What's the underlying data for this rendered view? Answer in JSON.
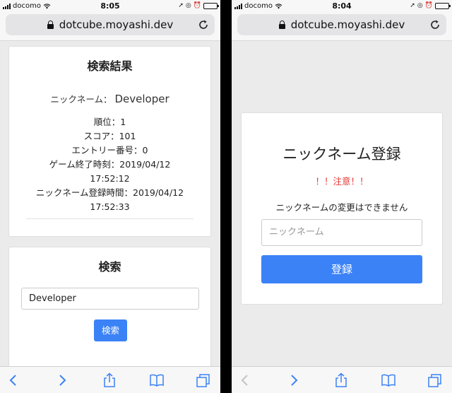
{
  "left": {
    "status": {
      "carrier": "docomo",
      "time": "8:05"
    },
    "url": "dotcube.moyashi.dev",
    "results": {
      "title": "検索結果",
      "nickname_label": "ニックネーム：",
      "nickname_value": "Developer",
      "lines": [
        "順位：1",
        "スコア：101",
        "エントリー番号：0",
        "ゲーム終了時刻：2019/04/12",
        "17:52:12",
        "ニックネーム登録時間：2019/04/12",
        "17:52:33"
      ]
    },
    "search": {
      "title": "検索",
      "input_value": "Developer",
      "button_label": "検索"
    }
  },
  "right": {
    "status": {
      "carrier": "docomo",
      "time": "8:04"
    },
    "url": "dotcube.moyashi.dev",
    "register": {
      "title": "ニックネーム登録",
      "warning": "！！注意！！",
      "note": "ニックネームの変更はできません",
      "input_placeholder": "ニックネーム",
      "button_label": "登録"
    }
  },
  "colors": {
    "primary": "#3b82f6",
    "warning": "#e53935",
    "background": "#ebebeb"
  },
  "icons": [
    "lock-icon",
    "reload-icon",
    "back-icon",
    "forward-icon",
    "share-icon",
    "bookmarks-icon",
    "tabs-icon"
  ]
}
